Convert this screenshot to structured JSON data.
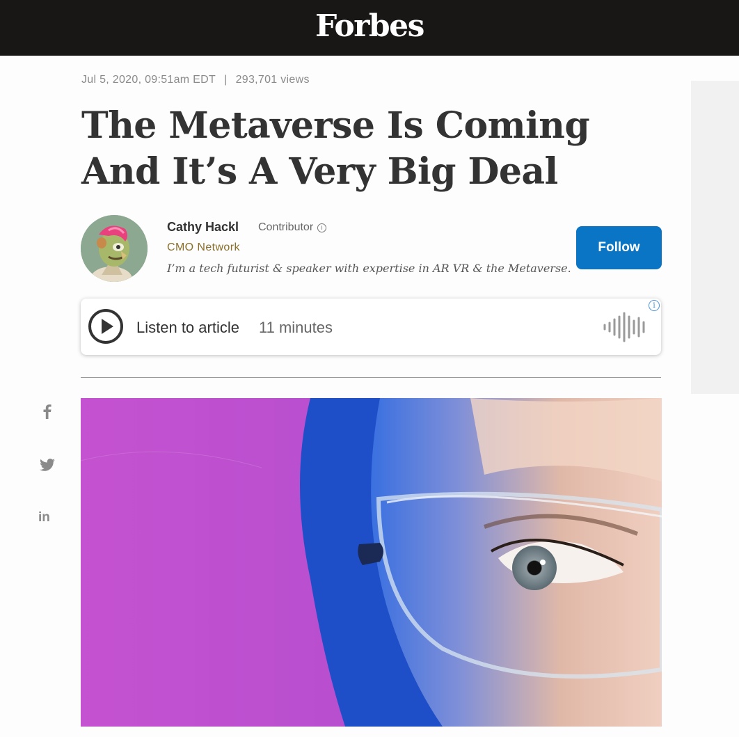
{
  "header": {
    "logo_text": "Forbes",
    "background": "#181716"
  },
  "article": {
    "date": "Jul 5, 2020, 09:51am EDT",
    "separator": "|",
    "views": "293,701 views",
    "headline": "The Metaverse Is Coming And It’s A Very Big Deal"
  },
  "author": {
    "name": "Cathy Hackl",
    "role": "Contributor",
    "network": "CMO Network",
    "bio": "I’m a tech futurist & speaker with expertise in AR VR & the Metaverse.",
    "follow_label": "Follow"
  },
  "listen": {
    "label": "Listen to article",
    "duration": "11 minutes",
    "icons": [
      "play-icon",
      "audio-wave-icon",
      "info-icon"
    ]
  },
  "share": {
    "facebook_glyph": "f",
    "linkedin_glyph": "in"
  },
  "colors": {
    "accent": "#0a74c5",
    "network": "#8a6f2a",
    "hero_background": "#c552d0"
  }
}
